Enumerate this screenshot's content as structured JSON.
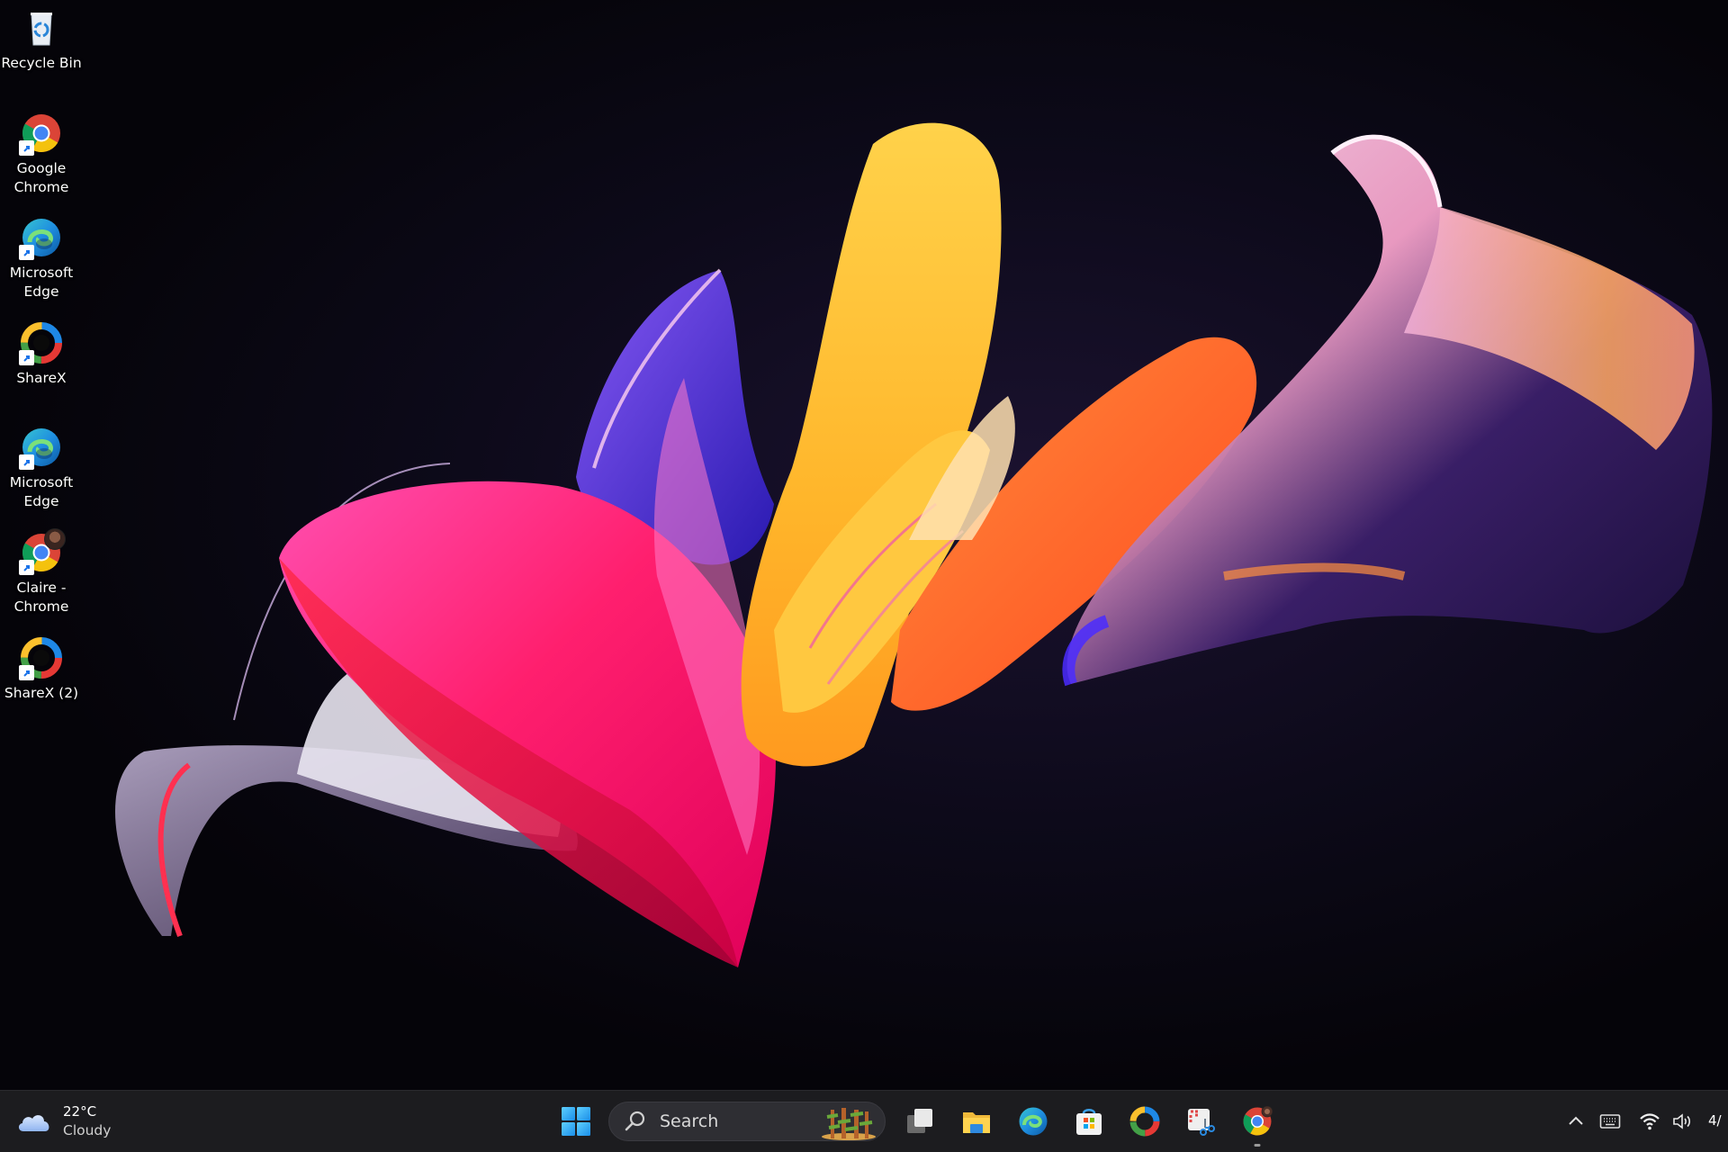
{
  "desktop": {
    "wallpaper": "windows-11-bloom-abstract-ribbons",
    "icons": [
      {
        "label": "Recycle Bin",
        "icon": "recycle-bin-icon",
        "shortcut": false
      },
      {
        "label": "Google Chrome",
        "icon": "chrome-icon",
        "shortcut": true
      },
      {
        "label": "Microsoft Edge",
        "icon": "edge-icon",
        "shortcut": true
      },
      {
        "label": "ShareX",
        "icon": "sharex-icon",
        "shortcut": true
      },
      {
        "label": "Microsoft Edge",
        "icon": "edge-icon",
        "shortcut": true
      },
      {
        "label": "Claire - Chrome",
        "icon": "chrome-profile-icon",
        "shortcut": true
      },
      {
        "label": "ShareX (2)",
        "icon": "sharex-icon",
        "shortcut": true
      }
    ]
  },
  "taskbar": {
    "weather": {
      "temperature": "22°C",
      "condition": "Cloudy",
      "icon": "cloud-icon"
    },
    "start": {
      "icon": "windows-start-icon"
    },
    "search": {
      "placeholder": "Search",
      "icon": "search-icon",
      "highlight_icon": "search-highlight-trees-icon"
    },
    "pinned": [
      {
        "name": "Task View",
        "icon": "task-view-icon"
      },
      {
        "name": "File Explorer",
        "icon": "file-explorer-icon"
      },
      {
        "name": "Microsoft Edge",
        "icon": "edge-icon"
      },
      {
        "name": "Microsoft Store",
        "icon": "store-icon"
      },
      {
        "name": "ShareX",
        "icon": "sharex-icon"
      },
      {
        "name": "Snipping Tool",
        "icon": "snipping-tool-icon"
      },
      {
        "name": "Google Chrome (Claire)",
        "icon": "chrome-profile-icon",
        "running": true
      }
    ],
    "tray": {
      "overflow_icon": "chevron-up-icon",
      "keyboard_icon": "keyboard-icon",
      "wifi_icon": "wifi-icon",
      "volume_icon": "volume-icon",
      "clock_partial": "4/"
    }
  },
  "colors": {
    "taskbar_bg": "#1c1c1f",
    "search_bg": "#2e2e33",
    "start_blue": "#38b6f5"
  }
}
